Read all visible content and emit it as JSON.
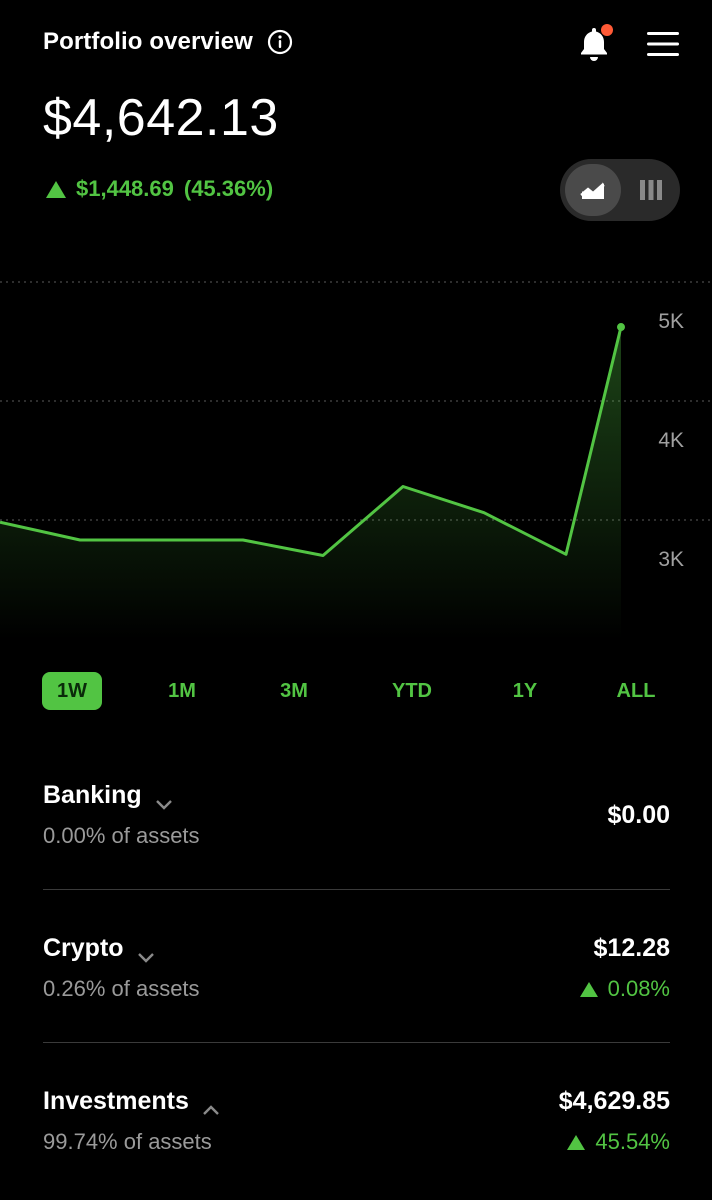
{
  "header": {
    "title": "Portfolio overview",
    "balance": "$4,642.13",
    "change_amount": "$1,448.69",
    "change_percent": "(45.36%)"
  },
  "colors": {
    "accent": "#52c443",
    "notification_dot": "#ff5a36",
    "background": "#000000",
    "muted_text": "#9a9a9a"
  },
  "icons": {
    "info": "info-circle-icon",
    "bell": "bell-icon",
    "menu": "hamburger-menu-icon",
    "line_chart": "line-chart-icon",
    "bar_chart": "bar-chart-icon"
  },
  "chart_data": {
    "type": "line",
    "x": [
      0,
      1,
      2,
      3,
      4,
      5,
      6,
      7,
      8
    ],
    "values": [
      3200,
      3050,
      3050,
      3050,
      2920,
      3500,
      3280,
      2930,
      4840
    ],
    "y_ticks": [
      "5K",
      "4K",
      "3K"
    ],
    "y_tick_values": [
      5000,
      4000,
      3000
    ],
    "ylim": [
      2000,
      5200
    ],
    "grid": true,
    "fill": "area-gradient"
  },
  "time_ranges": [
    {
      "label": "1W",
      "active": true
    },
    {
      "label": "1M",
      "active": false
    },
    {
      "label": "3M",
      "active": false
    },
    {
      "label": "YTD",
      "active": false
    },
    {
      "label": "1Y",
      "active": false
    },
    {
      "label": "ALL",
      "active": false
    }
  ],
  "accounts": [
    {
      "name": "Banking",
      "share": "0.00% of assets",
      "value": "$0.00",
      "change": ""
    },
    {
      "name": "Crypto",
      "share": "0.26% of assets",
      "value": "$12.28",
      "change": "0.08%"
    },
    {
      "name": "Investments",
      "share": "99.74% of assets",
      "value": "$4,629.85",
      "change": "45.54%"
    }
  ]
}
